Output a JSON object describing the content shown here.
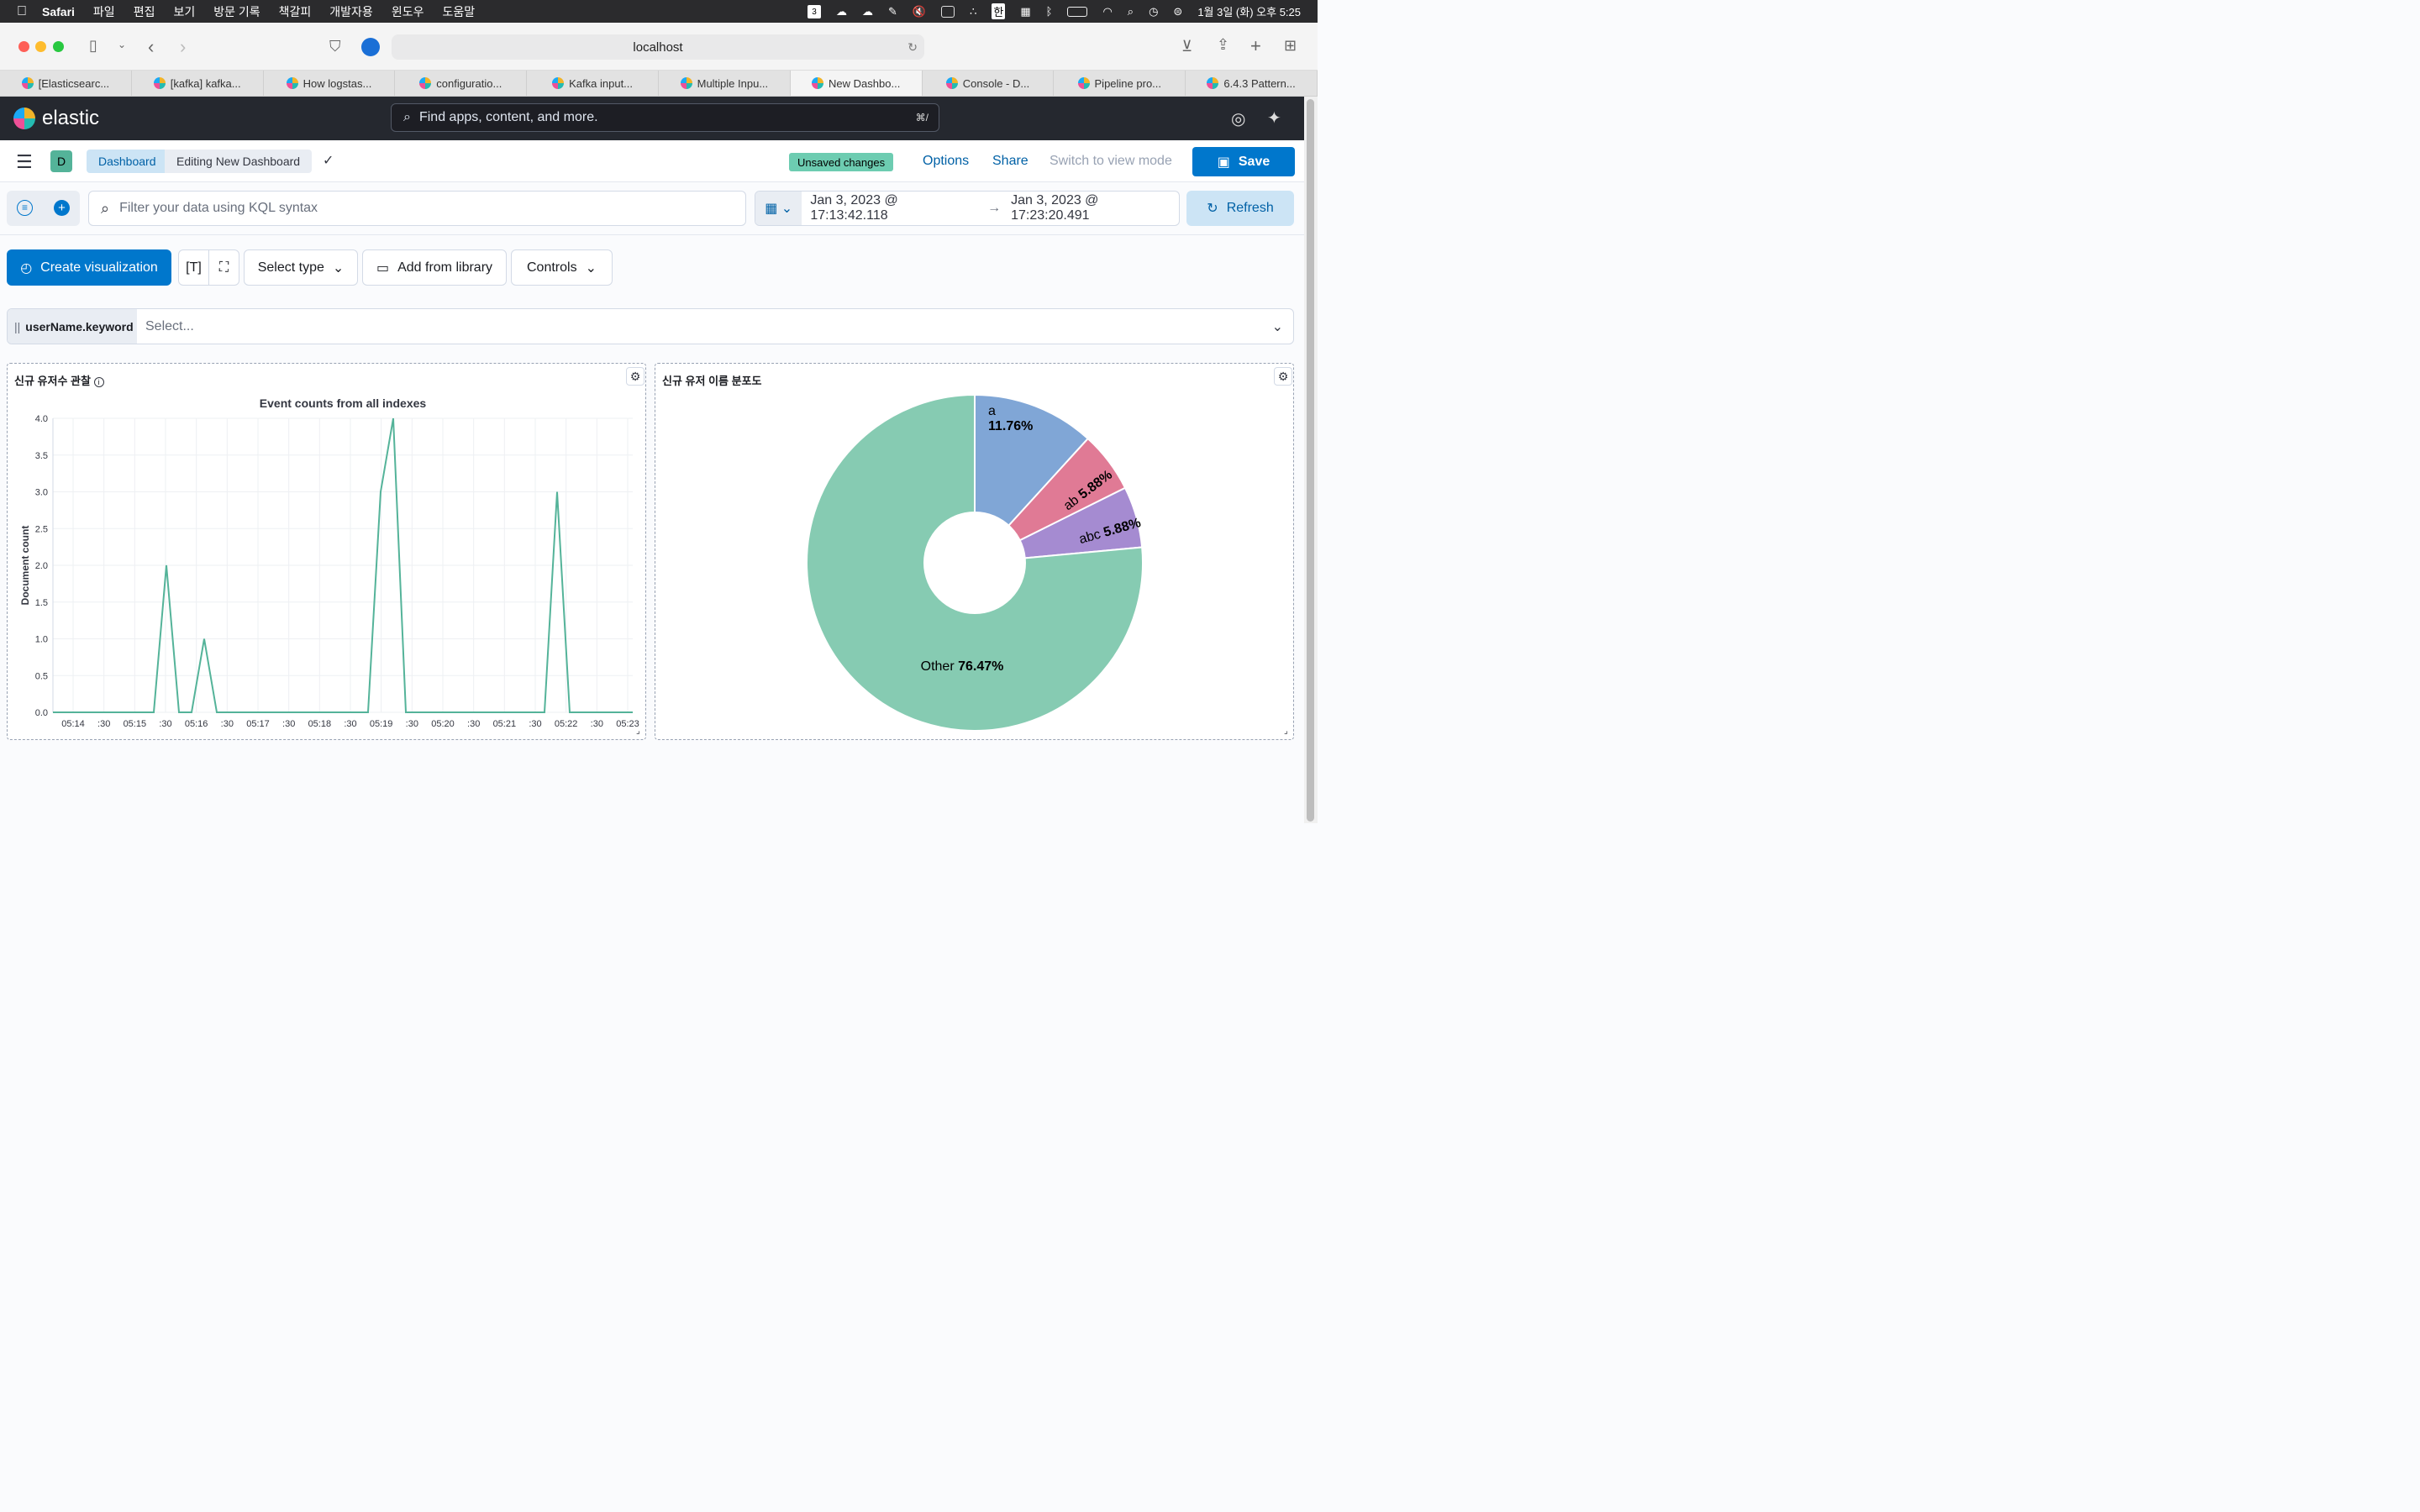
{
  "menubar": {
    "app": "Safari",
    "items": [
      "파일",
      "편집",
      "보기",
      "방문 기록",
      "책갈피",
      "개발자용",
      "윈도우",
      "도움말"
    ],
    "clock": "1월 3일 (화) 오후 5:25",
    "cal_day": "3",
    "ime": "한"
  },
  "browser": {
    "url": "localhost",
    "tabs": [
      {
        "label": "[Elasticsearc...",
        "active": false
      },
      {
        "label": "[kafka] kafka...",
        "active": false
      },
      {
        "label": "How logstas...",
        "active": false
      },
      {
        "label": "configuratio...",
        "active": false
      },
      {
        "label": "Kafka input...",
        "active": false
      },
      {
        "label": "Multiple Inpu...",
        "active": false
      },
      {
        "label": "New Dashbo...",
        "active": true
      },
      {
        "label": "Console - D...",
        "active": false
      },
      {
        "label": "Pipeline pro...",
        "active": false
      },
      {
        "label": "6.4.3 Pattern...",
        "active": false
      }
    ]
  },
  "kibana": {
    "brand": "elastic",
    "search_placeholder": "Find apps, content, and more.",
    "search_shortcut": "⌘/",
    "space_initial": "D",
    "breadcrumbs": [
      "Dashboard",
      "Editing New Dashboard"
    ],
    "unsaved_badge": "Unsaved changes",
    "header_links": {
      "options": "Options",
      "share": "Share",
      "switch_mode": "Switch to view mode"
    },
    "save_label": "Save",
    "kql_placeholder": "Filter your data using KQL syntax",
    "date_start": "Jan 3, 2023 @ 17:13:42.118",
    "date_end": "Jan 3, 2023 @ 17:23:20.491",
    "date_arrow": "→",
    "refresh_label": "Refresh",
    "create_viz_label": "Create visualization",
    "select_type_label": "Select type",
    "add_library_label": "Add from library",
    "controls_label": "Controls",
    "control_field": "userName.keyword",
    "control_placeholder": "Select..."
  },
  "panels": {
    "left_title": "신규 유저수 관찰",
    "right_title": "신규 유저 이름 분포도"
  },
  "chart_data": [
    {
      "type": "line",
      "title": "Event counts from all indexes",
      "ylabel": "Document count",
      "xlabel": "",
      "ylim": [
        0,
        4
      ],
      "yticks": [
        "4.0",
        "3.5",
        "3.0",
        "2.5",
        "2.0",
        "1.5",
        "1.0",
        "0.5",
        "0.0"
      ],
      "xticks": [
        "05:14",
        ":30",
        "05:15",
        ":30",
        "05:16",
        ":30",
        "05:17",
        ":30",
        "05:18",
        ":30",
        "05:19",
        ":30",
        "05:20",
        ":30",
        "05:21",
        ":30",
        "05:22",
        ":30",
        "05:23"
      ],
      "x_minutes": [
        0,
        1.5,
        1.75,
        2,
        2.25,
        2.5,
        2.75,
        3,
        3.25,
        6,
        6.25,
        6.5,
        6.75,
        7,
        7.25,
        9.5,
        9.75,
        10,
        10.25,
        11.5
      ],
      "values": [
        0,
        0,
        0,
        0,
        2,
        0,
        0,
        1,
        0,
        0,
        0,
        3,
        4,
        0,
        0,
        0,
        0,
        3,
        0,
        0
      ],
      "color": "#54b399",
      "grid": true
    },
    {
      "type": "pie",
      "donut": true,
      "slices": [
        {
          "label": "a",
          "percent": 11.76,
          "text": "11.76%",
          "color": "#80a6d6"
        },
        {
          "label": "ab",
          "percent": 5.88,
          "text": "5.88%",
          "color": "#e07a95"
        },
        {
          "label": "abc",
          "percent": 5.88,
          "text": "5.88%",
          "color": "#a58bd1"
        },
        {
          "label": "Other",
          "percent": 76.47,
          "text": "76.47%",
          "color": "#86cbb2"
        }
      ]
    }
  ]
}
